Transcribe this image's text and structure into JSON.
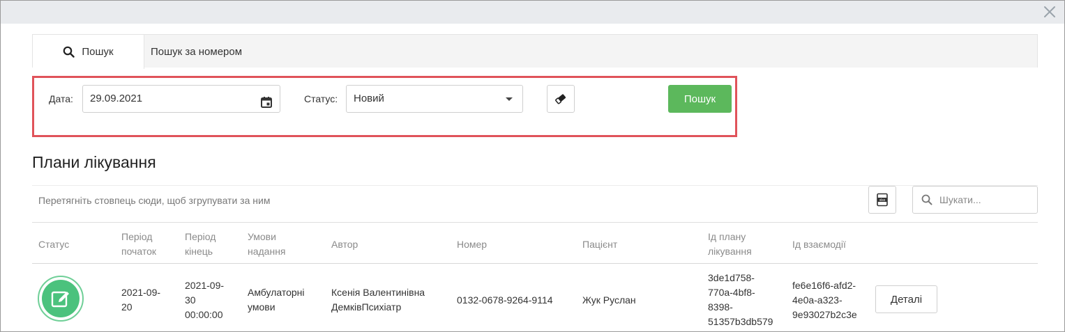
{
  "tabs": {
    "search": "Пошук",
    "search_by_number": "Пошук за номером"
  },
  "filters": {
    "date_label": "Дата:",
    "date_value": "29.09.2021",
    "status_label": "Статус:",
    "status_value": "Новий",
    "search_button": "Пошук"
  },
  "section": {
    "title": "Плани лікування"
  },
  "grid": {
    "group_hint": "Перетягніть стовпець сюди, щоб згрупувати за ним",
    "search_placeholder": "Шукати...",
    "columns": {
      "status": "Статус",
      "period_start_1": "Період",
      "period_start_2": "початок",
      "period_end_1": "Період",
      "period_end_2": "кінець",
      "conditions_1": "Умови",
      "conditions_2": "надання",
      "author": "Автор",
      "number": "Номер",
      "patient": "Пацієнт",
      "plan_id_1": "Ід плану",
      "plan_id_2": "лікування",
      "interaction_id": "Ід взаємодії"
    },
    "row": {
      "start_1": "2021-09-",
      "start_2": "20",
      "end_1": "2021-09-",
      "end_2": "30",
      "end_3": "00:00:00",
      "conditions_1": "Амбулаторні",
      "conditions_2": "умови",
      "author_1": "Ксенія Валентинівна",
      "author_2": "ДемківПсихіатр",
      "number": "0132-0678-9264-9114",
      "patient": "Жук Руслан",
      "plan_id_1": "3de1d758-",
      "plan_id_2": "770a-4bf8-",
      "plan_id_3": "8398-",
      "plan_id_4": "51357b3db579",
      "interaction_id_1": "fe6e16f6-afd2-",
      "interaction_id_2": "4e0a-a323-",
      "interaction_id_3": "9e93027b2c3e",
      "details_button": "Деталі"
    }
  },
  "colors": {
    "accent_green": "#5cb85c",
    "status_green": "#4bc27d",
    "highlight_red": "#e0535a"
  }
}
